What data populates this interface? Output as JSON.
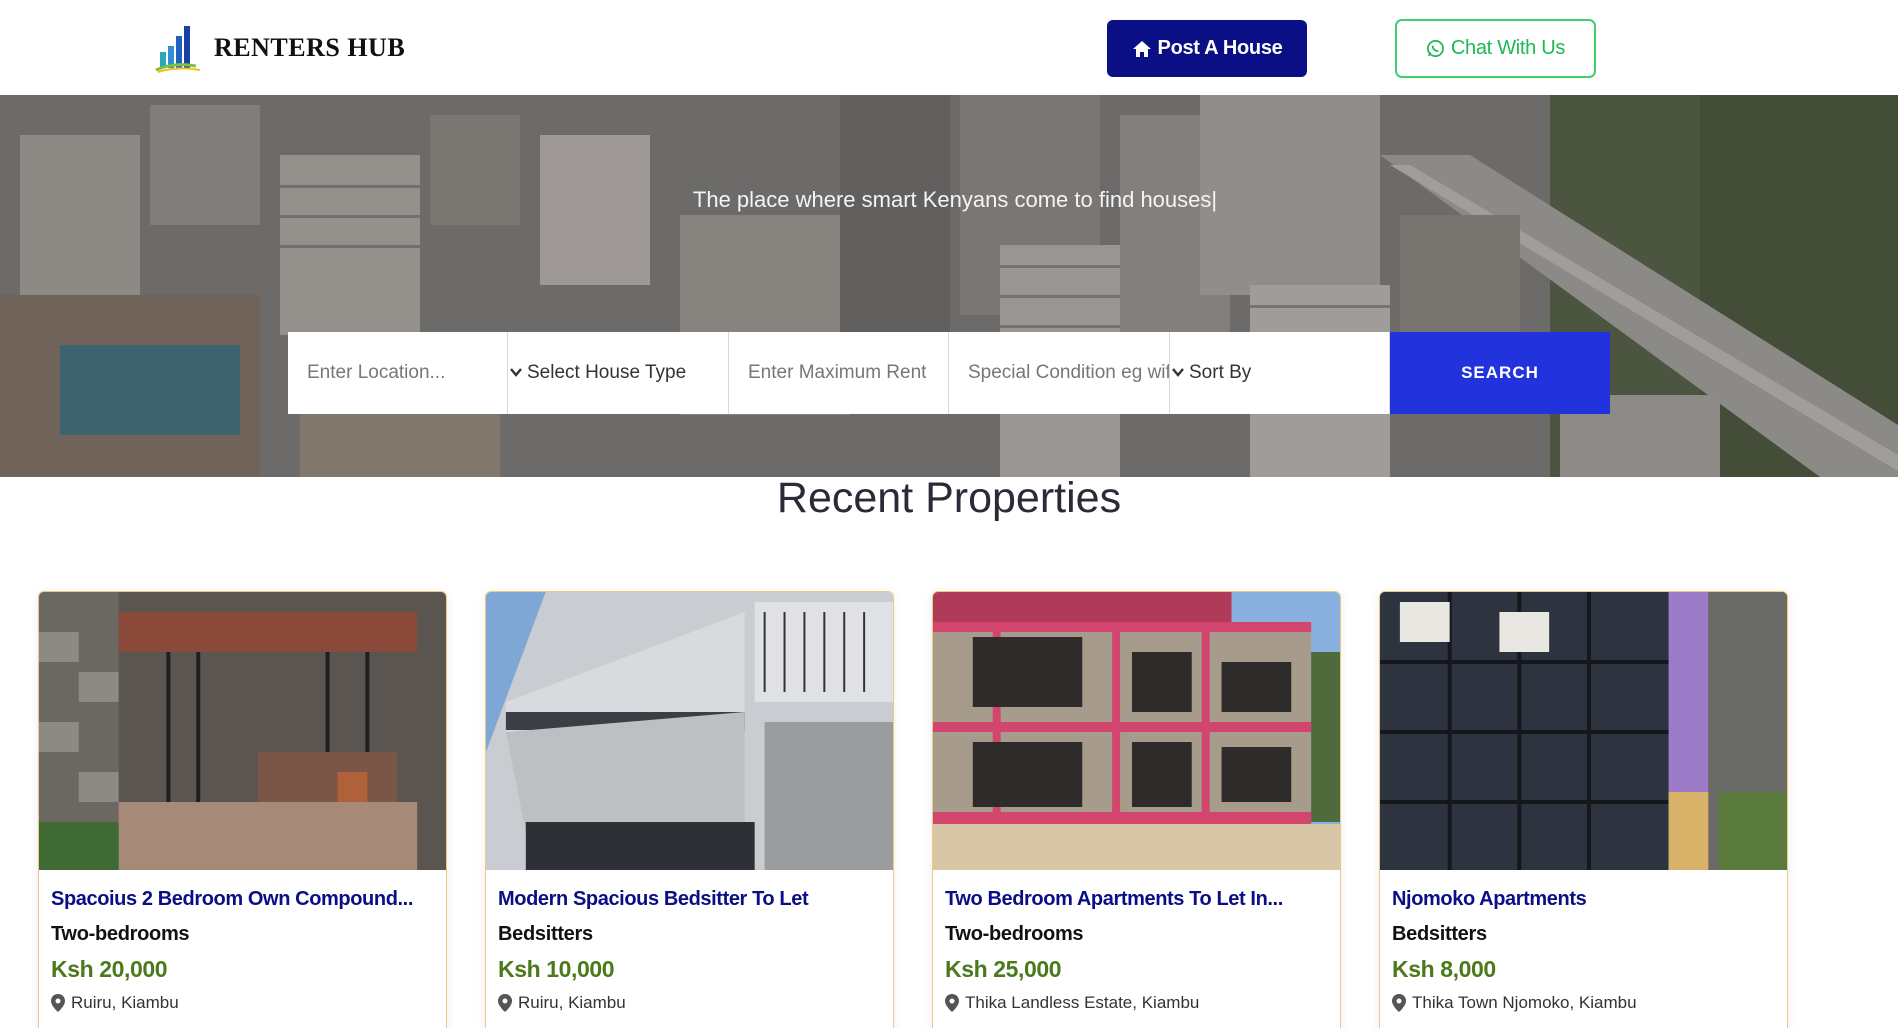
{
  "header": {
    "logo_text": "RENTERS HUB",
    "post_button": "Post A House",
    "chat_button": "Chat With Us"
  },
  "hero": {
    "tagline": "The place where smart Kenyans come to find houses|",
    "search": {
      "location_placeholder": "Enter Location...",
      "house_type_selected": "Select House Type",
      "max_rent_placeholder": "Enter Maximum Rent",
      "special_condition_placeholder": "Special Condition eg wifi",
      "sort_selected": "Sort By",
      "search_button": "SEARCH"
    }
  },
  "recent": {
    "title": "Recent Properties",
    "cards": [
      {
        "title": "Spacoius 2 Bedroom Own Compound...",
        "type": "Two-bedrooms",
        "price": "Ksh 20,000",
        "location": "Ruiru, Kiambu"
      },
      {
        "title": "Modern Spacious Bedsitter To Let",
        "type": "Bedsitters",
        "price": "Ksh 10,000",
        "location": "Ruiru, Kiambu"
      },
      {
        "title": "Two Bedroom Apartments To Let In...",
        "type": "Two-bedrooms",
        "price": "Ksh 25,000",
        "location": "Thika Landless Estate, Kiambu"
      },
      {
        "title": "Njomoko Apartments",
        "type": "Bedsitters",
        "price": "Ksh 8,000",
        "location": "Thika Town Njomoko, Kiambu"
      }
    ]
  },
  "colors": {
    "brand_navy": "#0b0f86",
    "search_blue": "#2233dd",
    "chat_green": "#1db954",
    "price_green": "#4a7a1c",
    "card_border": "#f0c987"
  }
}
